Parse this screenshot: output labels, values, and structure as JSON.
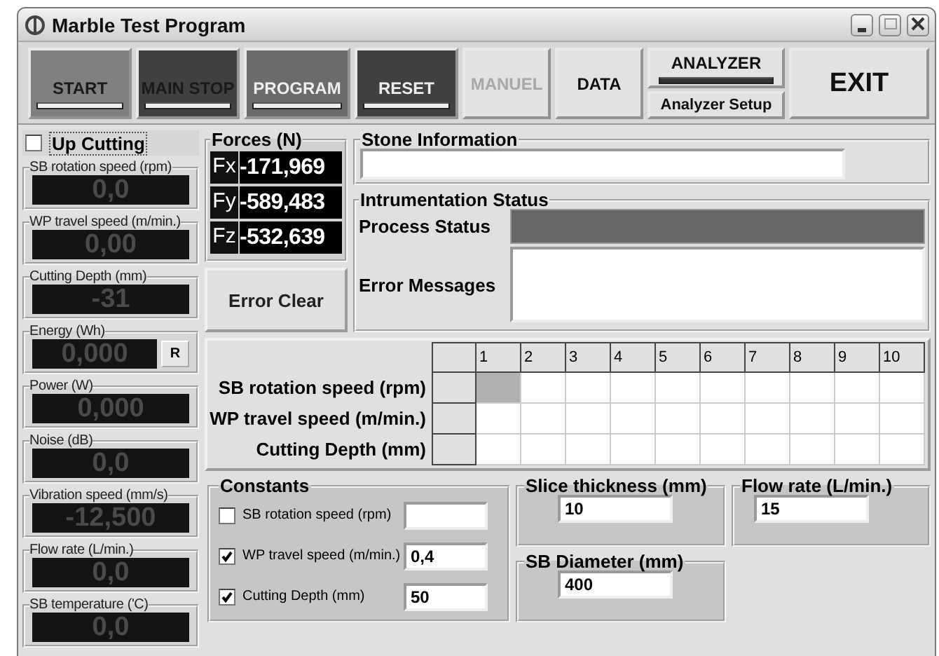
{
  "window": {
    "title": "Marble Test Program"
  },
  "toolbar": [
    {
      "label": "START",
      "kind": "indicator",
      "color": "#808080",
      "light_text": false,
      "disabled": false
    },
    {
      "label": "MAIN STOP",
      "kind": "indicator",
      "color": "#404040",
      "light_text": false,
      "disabled": false
    },
    {
      "label": "PROGRAM",
      "kind": "indicator",
      "color": "#6b6b6b",
      "light_text": true,
      "disabled": false
    },
    {
      "label": "RESET",
      "kind": "indicator",
      "color": "#404040",
      "light_text": true,
      "disabled": false
    },
    {
      "label": "MANUEL",
      "kind": "plain",
      "disabled": true
    },
    {
      "label": "DATA",
      "kind": "plain",
      "disabled": false
    },
    {
      "label": "ANALYZER",
      "sub_label": "Analyzer Setup",
      "kind": "split",
      "disabled": false
    },
    {
      "label": "EXIT",
      "kind": "large",
      "disabled": false
    }
  ],
  "up_cutting": {
    "label": "Up Cutting",
    "checked": false
  },
  "gauges": [
    {
      "label": "SB rotation speed (rpm)",
      "value": "0,0"
    },
    {
      "label": "WP travel speed (m/min.)",
      "value": "0,00"
    },
    {
      "label": "Cutting Depth (mm)",
      "value": "-31"
    },
    {
      "label": "Energy (Wh)",
      "value": "0,000",
      "reset_button": "R"
    },
    {
      "label": "Power (W)",
      "value": "0,000"
    },
    {
      "label": "Noise (dB)",
      "value": "0,0"
    },
    {
      "label": "Vibration speed (mm/s)",
      "value": "-12,500"
    },
    {
      "label": "Flow rate (L/min.)",
      "value": "0,0"
    },
    {
      "label": "SB temperature ('C)",
      "value": "0,0"
    }
  ],
  "forces": {
    "title": "Forces (N)",
    "items": [
      {
        "axis": "Fx",
        "value": "-171,969"
      },
      {
        "axis": "Fy",
        "value": "-589,483"
      },
      {
        "axis": "Fz",
        "value": "-532,639"
      }
    ]
  },
  "error_clear_button": "Error Clear",
  "stone_information": {
    "title": "Stone Information"
  },
  "instrumentation_status": {
    "title": "Intrumentation Status",
    "process_status_label": "Process Status",
    "error_messages_label": "Error Messages"
  },
  "grid": {
    "columns": [
      "1",
      "2",
      "3",
      "4",
      "5",
      "6",
      "7",
      "8",
      "9",
      "10"
    ],
    "rows": [
      {
        "label": "SB rotation speed (rpm)",
        "cells": [
          {
            "selected": true
          },
          {
            "selected": false
          },
          {
            "selected": false
          },
          {
            "selected": false
          },
          {
            "selected": false
          },
          {
            "selected": false
          },
          {
            "selected": false
          },
          {
            "selected": false
          },
          {
            "selected": false
          },
          {
            "selected": false
          }
        ]
      },
      {
        "label": "WP travel speed (m/min.)",
        "cells": [
          {
            "selected": false
          },
          {
            "selected": false
          },
          {
            "selected": false
          },
          {
            "selected": false
          },
          {
            "selected": false
          },
          {
            "selected": false
          },
          {
            "selected": false
          },
          {
            "selected": false
          },
          {
            "selected": false
          },
          {
            "selected": false
          }
        ]
      },
      {
        "label": "Cutting Depth (mm)",
        "cells": [
          {
            "selected": false
          },
          {
            "selected": false
          },
          {
            "selected": false
          },
          {
            "selected": false
          },
          {
            "selected": false
          },
          {
            "selected": false
          },
          {
            "selected": false
          },
          {
            "selected": false
          },
          {
            "selected": false
          },
          {
            "selected": false
          }
        ]
      }
    ]
  },
  "constants": {
    "title": "Constants",
    "items": [
      {
        "label": "SB rotation speed (rpm)",
        "checked": false
      },
      {
        "label": "WP travel speed (m/min.)",
        "checked": true,
        "value": "0,4"
      },
      {
        "label": "Cutting Depth (mm)",
        "checked": true,
        "value": "50"
      }
    ]
  },
  "slice_thickness": {
    "title": "Slice thickness (mm)",
    "value": "10"
  },
  "flow_rate": {
    "title": "Flow rate (L/min.)",
    "value": "15"
  },
  "sb_diameter": {
    "title": "SB Diameter (mm)",
    "value": "400"
  }
}
